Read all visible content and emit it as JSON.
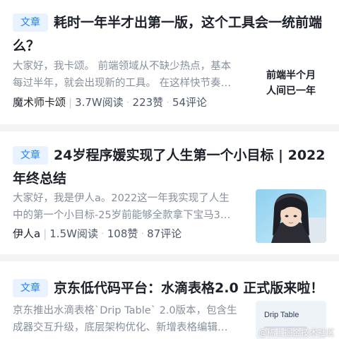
{
  "articles": [
    {
      "tag": "文章",
      "title": "耗时一年半才出第一版，这个工具会一统前端么？",
      "desc_line1": "大家好，我卡颂。 前端领域从不缺少热点，基本",
      "desc_line2": "每过半年，就会出现新的工具。 在这样快节奏…",
      "author": "魔术师卡颂",
      "reads": "3.7W阅读",
      "likes": "223赞",
      "comments": "54评论",
      "thumb_line1": "前端半个月",
      "thumb_line2": "人间已一年"
    },
    {
      "tag": "文章",
      "title": "24岁程序媛实现了人生第一个小目标 | 2022年终总结",
      "desc_line1": "大家好，我是伊人a。2022这一年我实现了人生",
      "desc_line2": "中的第一个小目标-25岁前能够全款拿下宝马3…",
      "author": "伊人a",
      "reads": "1.5W阅读",
      "likes": "108赞",
      "comments": "87评论"
    },
    {
      "tag": "文章",
      "title": "京东低代码平台：水滴表格2.0 正式版来啦！",
      "desc_line1": "京东推出水滴表格`Drip Table` 2.0版本，包含生",
      "desc_line2": "成器交互升级，底层架构优化、新增表格编辑…",
      "thumb_text": "Drip Table",
      "watermark": "@稀土掘金技术社区"
    }
  ],
  "colors": {
    "tag_bg": "#e8f3ff",
    "tag_text": "#1e80ff",
    "separator": "#f2f3f5"
  }
}
